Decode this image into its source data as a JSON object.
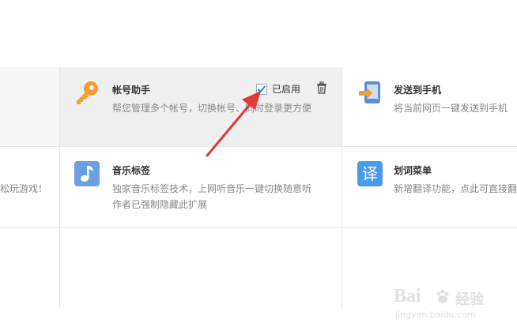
{
  "extensions": [
    {
      "title": "",
      "description": "松玩游戏！"
    },
    {
      "title": "帐号助手",
      "description": "帮您管理多个帐号，切换帐号、同时登录更方便",
      "status": "已启用",
      "icon": "key-icon",
      "icon_color": "#f0a030"
    },
    {
      "title": "发送到手机",
      "description": "将当前网页一键发送到手机",
      "icon": "send-to-phone-icon",
      "icon_color": "#5b8fd6"
    },
    {
      "title": "音乐标签",
      "description_line1": "独家音乐标签技术，上网听音乐一键切换随意听",
      "description_line2": "作者已强制隐藏此扩展",
      "icon": "music-note-icon",
      "icon_color": "#6aa0e0"
    },
    {
      "title": "划词菜单",
      "description": "新增翻译功能，点此可直接翻",
      "icon": "translate-icon",
      "icon_glyph": "译",
      "icon_color": "#4a9be8"
    }
  ],
  "watermark": {
    "brand": "Bai",
    "brand_cn": "经验",
    "url": "jingyan.baidu.com"
  },
  "colors": {
    "hover_bg": "#f0f0f0",
    "arrow": "#e03a3a",
    "check": "#2f7fe0"
  }
}
